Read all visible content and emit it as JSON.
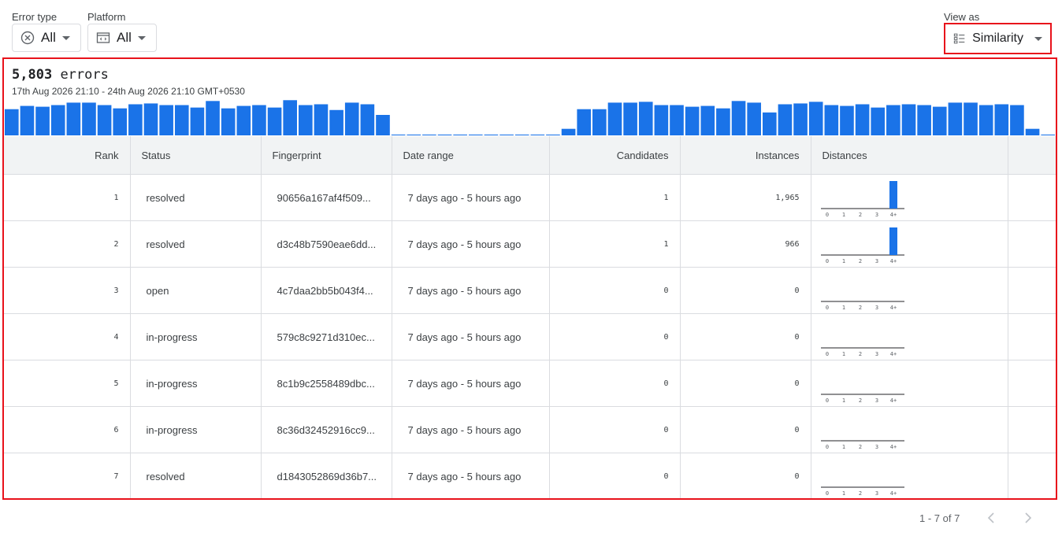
{
  "filters": {
    "error_type": {
      "label": "Error type",
      "value": "All",
      "icon": "x-circle-icon"
    },
    "platform": {
      "label": "Platform",
      "value": "All",
      "icon": "code-window-icon"
    },
    "view_as": {
      "label": "View as",
      "value": "Similarity",
      "icon": "list-icon"
    }
  },
  "summary": {
    "count": "5,803",
    "unit": "errors",
    "range": "17th Aug 2026 21:10 - 24th Aug 2026 21:10 GMT+0530"
  },
  "histogram": {
    "color": "#1a73e8",
    "values": [
      32,
      36,
      35,
      37,
      40,
      40,
      37,
      33,
      38,
      39,
      37,
      37,
      34,
      42,
      33,
      36,
      37,
      34,
      43,
      37,
      38,
      31,
      40,
      38,
      25,
      1,
      1,
      1,
      1,
      1,
      1,
      1,
      1,
      1,
      1,
      1,
      8,
      32,
      32,
      40,
      40,
      41,
      37,
      37,
      35,
      36,
      33,
      42,
      40,
      28,
      38,
      39,
      41,
      37,
      36,
      38,
      34,
      37,
      38,
      37,
      35,
      40,
      40,
      37,
      38,
      37,
      8,
      1
    ]
  },
  "table": {
    "headers": [
      "Rank",
      "Status",
      "Fingerprint",
      "Date range",
      "Candidates",
      "Instances",
      "Distances"
    ],
    "distance_labels": [
      "0",
      "1",
      "2",
      "3",
      "4+"
    ],
    "rows": [
      {
        "rank": "1",
        "status": "resolved",
        "fingerprint": "90656a167af4f509...",
        "date_range": "7 days ago - 5 hours ago",
        "candidates": "1",
        "instances": "1,965",
        "distances": [
          0,
          0,
          0,
          0,
          1
        ]
      },
      {
        "rank": "2",
        "status": "resolved",
        "fingerprint": "d3c48b7590eae6dd...",
        "date_range": "7 days ago - 5 hours ago",
        "candidates": "1",
        "instances": "966",
        "distances": [
          0,
          0,
          0,
          0,
          1
        ]
      },
      {
        "rank": "3",
        "status": "open",
        "fingerprint": "4c7daa2bb5b043f4...",
        "date_range": "7 days ago - 5 hours ago",
        "candidates": "0",
        "instances": "0",
        "distances": [
          0,
          0,
          0,
          0,
          0
        ]
      },
      {
        "rank": "4",
        "status": "in-progress",
        "fingerprint": "579c8c9271d310ec...",
        "date_range": "7 days ago - 5 hours ago",
        "candidates": "0",
        "instances": "0",
        "distances": [
          0,
          0,
          0,
          0,
          0
        ]
      },
      {
        "rank": "5",
        "status": "in-progress",
        "fingerprint": "8c1b9c2558489dbc...",
        "date_range": "7 days ago - 5 hours ago",
        "candidates": "0",
        "instances": "0",
        "distances": [
          0,
          0,
          0,
          0,
          0
        ]
      },
      {
        "rank": "6",
        "status": "in-progress",
        "fingerprint": "8c36d32452916cc9...",
        "date_range": "7 days ago - 5 hours ago",
        "candidates": "0",
        "instances": "0",
        "distances": [
          0,
          0,
          0,
          0,
          0
        ]
      },
      {
        "rank": "7",
        "status": "resolved",
        "fingerprint": "d1843052869d36b7...",
        "date_range": "7 days ago - 5 hours ago",
        "candidates": "0",
        "instances": "0",
        "distances": [
          0,
          0,
          0,
          0,
          0
        ]
      }
    ]
  },
  "pagination": {
    "text": "1 - 7 of 7",
    "prev_icon": "chevron-left-icon",
    "next_icon": "chevron-right-icon"
  }
}
